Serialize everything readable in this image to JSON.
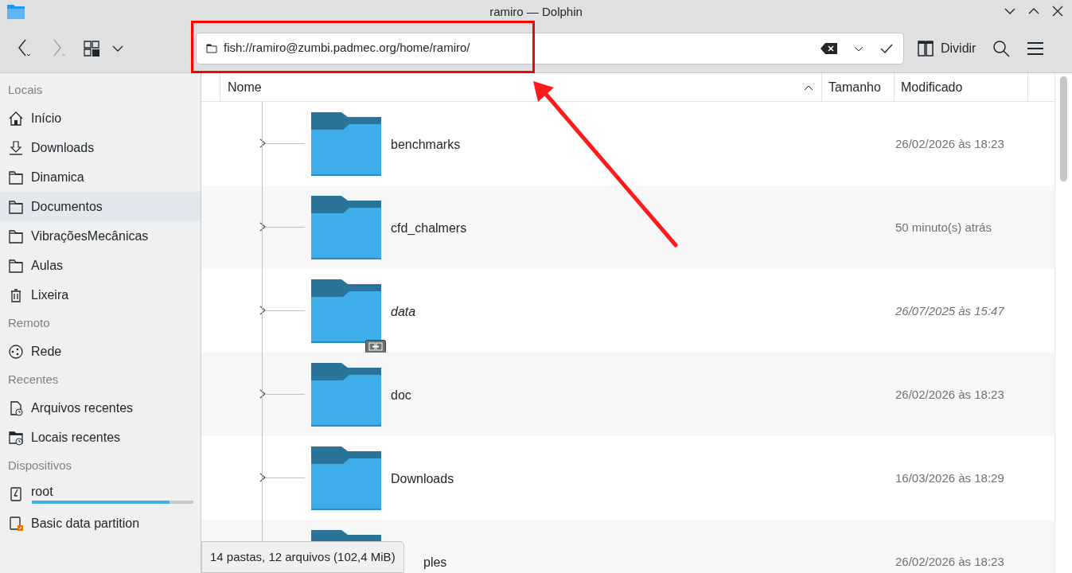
{
  "window": {
    "title": "ramiro — Dolphin"
  },
  "toolbar": {
    "address": "fish://ramiro@zumbi.padmec.org/home/ramiro/",
    "split_button": "Dividir"
  },
  "sidebar": {
    "sections": [
      {
        "title": "Locais",
        "items": [
          {
            "label": "Início",
            "kind": "home",
            "selected": false
          },
          {
            "label": "Downloads",
            "kind": "download",
            "selected": false
          },
          {
            "label": "Dinamica",
            "kind": "folder",
            "selected": false
          },
          {
            "label": "Documentos",
            "kind": "folder",
            "selected": true
          },
          {
            "label": "VibraçõesMecânicas",
            "kind": "folder",
            "selected": false
          },
          {
            "label": "Aulas",
            "kind": "folder",
            "selected": false
          },
          {
            "label": "Lixeira",
            "kind": "trash",
            "selected": false
          }
        ]
      },
      {
        "title": "Remoto",
        "items": [
          {
            "label": "Rede",
            "kind": "network",
            "selected": false
          }
        ]
      },
      {
        "title": "Recentes",
        "items": [
          {
            "label": "Arquivos recentes",
            "kind": "recent-file",
            "selected": false
          },
          {
            "label": "Locais recentes",
            "kind": "recent-place",
            "selected": false
          }
        ]
      },
      {
        "title": "Dispositivos",
        "items": [
          {
            "label": "root",
            "kind": "drive",
            "selected": false,
            "level": 0.85
          },
          {
            "label": "Basic data partition",
            "kind": "partition",
            "selected": false
          }
        ]
      }
    ]
  },
  "table": {
    "columns": [
      "Nome",
      "Tamanho",
      "Modificado"
    ],
    "rows": [
      {
        "name": "benchmarks",
        "modified": "26/02/2026 às 18:23",
        "kind": "folder"
      },
      {
        "name": "cfd_chalmers",
        "modified": "50 minuto(s) atrás",
        "kind": "folder"
      },
      {
        "name": "data",
        "modified": "26/07/2025 às 15:47",
        "kind": "link"
      },
      {
        "name": "doc",
        "modified": "26/02/2026 às 18:23",
        "kind": "folder"
      },
      {
        "name": "Downloads",
        "modified": "16/03/2026 às 18:29",
        "kind": "folder"
      },
      {
        "name": "ples",
        "modified": "26/02/2026 às 18:23",
        "kind": "covered"
      }
    ]
  },
  "status_bar": "14 pastas, 12 arquivos (102,4 MiB)"
}
